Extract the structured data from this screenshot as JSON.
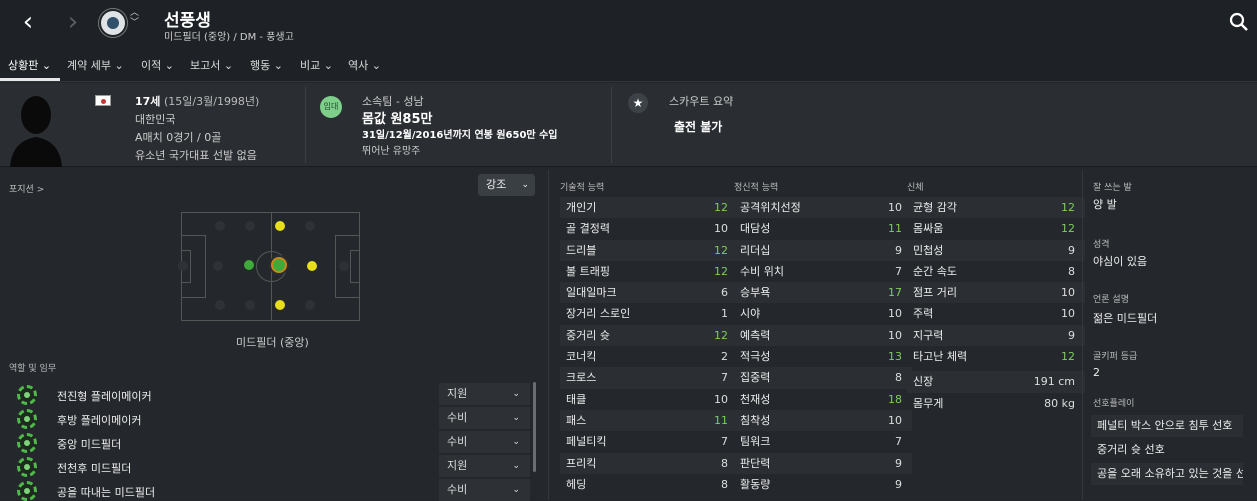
{
  "header": {
    "player_name": "선풍생",
    "subtitle": "미드필더 (중앙) / DM - 풍생고"
  },
  "tabs": [
    {
      "label": "상황판 ⌄"
    },
    {
      "label": "계약 세부 ⌄"
    },
    {
      "label": "이적 ⌄"
    },
    {
      "label": "보고서 ⌄"
    },
    {
      "label": "행동 ⌄"
    },
    {
      "label": "비교 ⌄"
    },
    {
      "label": "역사 ⌄"
    }
  ],
  "profile": {
    "age": "17세",
    "birth": "(15일/3월/1998년)",
    "nation": "대한민국",
    "caps": "A매치 0경기 / 0골",
    "youth": "유소년 국가대표 선발 없음",
    "loan_badge": "임대",
    "club_label": "소속팀 - 성남",
    "value": "몸값 원85만",
    "contract": "31일/12월/2016년까지 연봉 원650만 수입",
    "status": "뛰어난 유망주",
    "scout_title": "스카우트 요약",
    "scout_value": "출전 불가"
  },
  "positions": {
    "label": "포지션 >",
    "highlight_label": "강조",
    "selected_position": "미드필더 (중앙)"
  },
  "roles": {
    "title": "역할 및 임무",
    "items": [
      {
        "name": "전진형 플레이메이커",
        "duty": "지원"
      },
      {
        "name": "후방 플레이메이커",
        "duty": "수비"
      },
      {
        "name": "중앙 미드필더",
        "duty": "수비"
      },
      {
        "name": "전천후 미드필더",
        "duty": "지원"
      },
      {
        "name": "공을 따내는 미드필더",
        "duty": "수비"
      }
    ]
  },
  "technical": {
    "title": "기술적 능력",
    "attrs": [
      {
        "name": "개인기",
        "value": "12",
        "hi": true
      },
      {
        "name": "골 결정력",
        "value": "10",
        "hi": false
      },
      {
        "name": "드리블",
        "value": "12",
        "hi": true
      },
      {
        "name": "볼 트래핑",
        "value": "12",
        "hi": true
      },
      {
        "name": "일대일마크",
        "value": "6",
        "hi": false
      },
      {
        "name": "장거리 스로인",
        "value": "1",
        "hi": false
      },
      {
        "name": "중거리 슛",
        "value": "12",
        "hi": true
      },
      {
        "name": "코너킥",
        "value": "2",
        "hi": false
      },
      {
        "name": "크로스",
        "value": "7",
        "hi": false
      },
      {
        "name": "태클",
        "value": "10",
        "hi": false
      },
      {
        "name": "패스",
        "value": "11",
        "hi": true
      },
      {
        "name": "페널티킥",
        "value": "7",
        "hi": false
      },
      {
        "name": "프리킥",
        "value": "8",
        "hi": false
      },
      {
        "name": "헤딩",
        "value": "8",
        "hi": false
      }
    ]
  },
  "mental": {
    "title": "정신적 능력",
    "attrs": [
      {
        "name": "공격위치선정",
        "value": "10",
        "hi": false
      },
      {
        "name": "대담성",
        "value": "11",
        "hi": true
      },
      {
        "name": "리더십",
        "value": "9",
        "hi": false
      },
      {
        "name": "수비 위치",
        "value": "7",
        "hi": false
      },
      {
        "name": "승부욕",
        "value": "17",
        "hi": true
      },
      {
        "name": "시야",
        "value": "10",
        "hi": false
      },
      {
        "name": "예측력",
        "value": "10",
        "hi": false
      },
      {
        "name": "적극성",
        "value": "13",
        "hi": true
      },
      {
        "name": "집중력",
        "value": "8",
        "hi": false
      },
      {
        "name": "천재성",
        "value": "18",
        "hi": true
      },
      {
        "name": "침착성",
        "value": "10",
        "hi": false
      },
      {
        "name": "팀워크",
        "value": "7",
        "hi": false
      },
      {
        "name": "판단력",
        "value": "9",
        "hi": false
      },
      {
        "name": "활동량",
        "value": "9",
        "hi": false
      }
    ]
  },
  "physical": {
    "title": "신체",
    "attrs": [
      {
        "name": "균형 감각",
        "value": "12",
        "hi": true
      },
      {
        "name": "몸싸움",
        "value": "12",
        "hi": true
      },
      {
        "name": "민첩성",
        "value": "9",
        "hi": false
      },
      {
        "name": "순간 속도",
        "value": "8",
        "hi": false
      },
      {
        "name": "점프 거리",
        "value": "10",
        "hi": false
      },
      {
        "name": "주력",
        "value": "10",
        "hi": false
      },
      {
        "name": "지구력",
        "value": "9",
        "hi": false
      },
      {
        "name": "타고난 체력",
        "value": "12",
        "hi": true
      },
      {
        "name": "신장",
        "value": "191 cm",
        "hi": false
      },
      {
        "name": "몸무게",
        "value": "80 kg",
        "hi": false
      }
    ]
  },
  "personal": {
    "foot_label": "잘 쓰는 발",
    "foot": "양 발",
    "personality_label": "성격",
    "personality": "야심이 있음",
    "media_label": "언론 설명",
    "media": "젊은 미드필더",
    "gk_label": "골키퍼 등급",
    "gk": "2",
    "pref_label": "선호플레이",
    "prefs": [
      "페널티 박스 안으로 침투 선호",
      "중거리 슛 선호",
      "공을 오래 소유하고 있는 것을 선호"
    ]
  }
}
